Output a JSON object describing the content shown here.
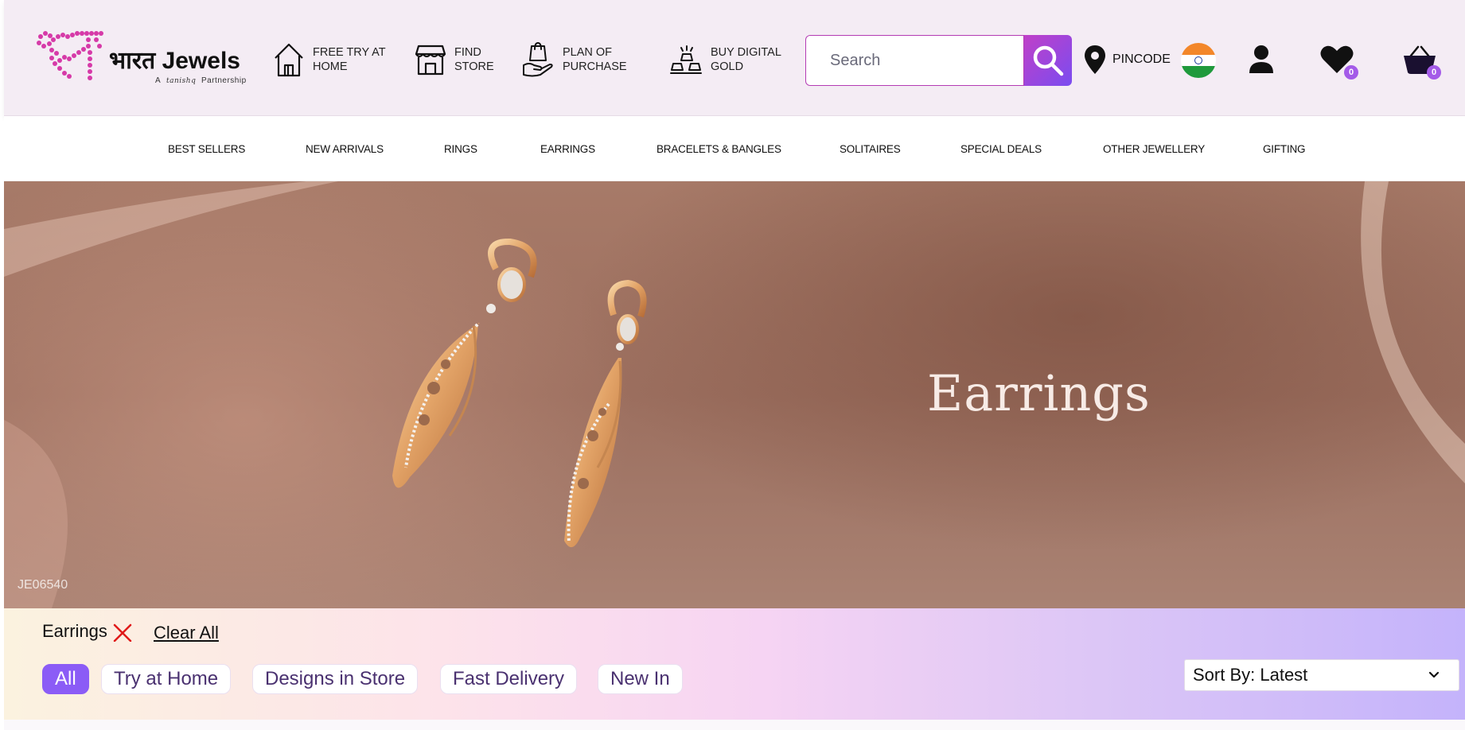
{
  "brand": {
    "name": "भारत Jewels",
    "tagline": "A tanishq Partnership",
    "colors": {
      "logo_pink": "#d63aa8",
      "accent_purple": "#8b5cf6"
    }
  },
  "utility_links": [
    {
      "label": "FREE TRY AT HOME",
      "icon": "house-icon"
    },
    {
      "label": "FIND STORE",
      "icon": "store-icon"
    },
    {
      "label": "PLAN OF PURCHASE",
      "icon": "hand-bag-icon"
    },
    {
      "label": "BUY DIGITAL GOLD",
      "icon": "gold-bars-icon"
    }
  ],
  "search": {
    "placeholder": "Search"
  },
  "pincode": {
    "label": "PINCODE"
  },
  "wishlist": {
    "count": "0"
  },
  "cart": {
    "count": "0"
  },
  "categories": [
    "BEST SELLERS",
    "NEW ARRIVALS",
    "RINGS",
    "EARRINGS",
    "BRACELETS & BANGLES",
    "SOLITAIRES",
    "SPECIAL DEALS",
    "OTHER JEWELLERY",
    "GIFTING"
  ],
  "banner": {
    "title": "Earrings",
    "product_code": "JE06540"
  },
  "filters": {
    "applied": [
      {
        "label": "Earrings"
      }
    ],
    "clear_all": "Clear All",
    "chips": [
      {
        "label": "All",
        "active": true
      },
      {
        "label": "Try at Home",
        "active": false
      },
      {
        "label": "Designs in Store",
        "active": false
      },
      {
        "label": "Fast Delivery",
        "active": false
      },
      {
        "label": "New In",
        "active": false
      }
    ],
    "sort": {
      "label": "Sort By: Latest"
    }
  }
}
